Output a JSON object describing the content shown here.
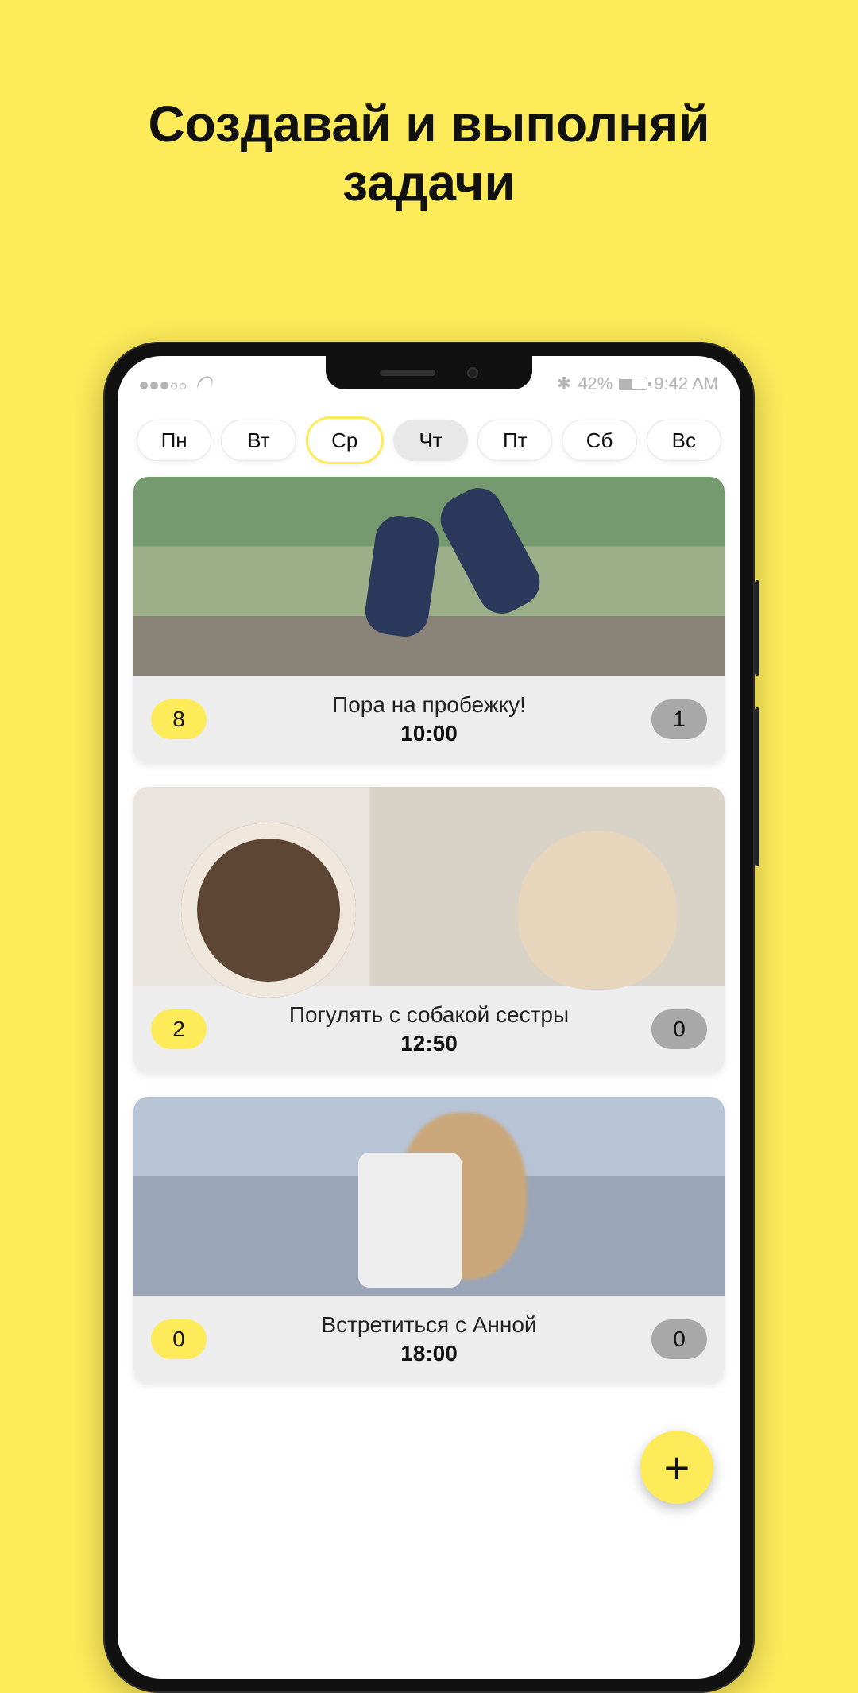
{
  "promo": {
    "title": "Создавай и выполняй\nзадачи"
  },
  "statusbar": {
    "battery_pct": "42%",
    "time": "9:42 AM"
  },
  "days": [
    {
      "label": "Пн",
      "state": ""
    },
    {
      "label": "Вт",
      "state": ""
    },
    {
      "label": "Ср",
      "state": "selected"
    },
    {
      "label": "Чт",
      "state": "today"
    },
    {
      "label": "Пт",
      "state": ""
    },
    {
      "label": "Сб",
      "state": ""
    },
    {
      "label": "Вс",
      "state": ""
    }
  ],
  "tasks": [
    {
      "title": "Пора на пробежку!",
      "time": "10:00",
      "left_count": "8",
      "right_count": "1",
      "image": "running"
    },
    {
      "title": "Погулять с собакой сестры",
      "time": "12:50",
      "left_count": "2",
      "right_count": "0",
      "image": "dog"
    },
    {
      "title": "Встретиться с Анной",
      "time": "18:00",
      "left_count": "0",
      "right_count": "0",
      "image": "cafe"
    }
  ],
  "fab": {
    "label": "+"
  }
}
